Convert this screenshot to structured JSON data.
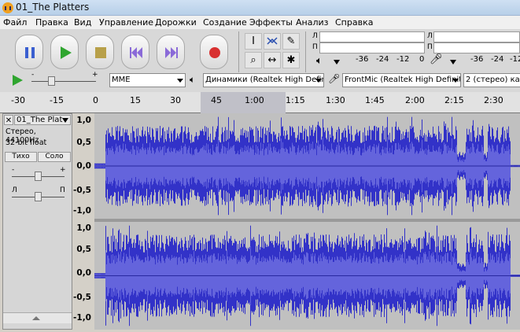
{
  "window": {
    "title": "01_The Platters"
  },
  "menu": [
    "Файл",
    "Правка",
    "Вид",
    "Управление",
    "Дорожки",
    "Создание",
    "Эффекты",
    "Анализ",
    "Справка"
  ],
  "meters": {
    "left": "Л",
    "right": "П",
    "ticks_play": [
      "-36",
      "-24",
      "-12",
      "0"
    ],
    "ticks_rec": [
      "-36",
      "-24",
      "-12"
    ]
  },
  "device": {
    "host": "MME",
    "output": "Динамики (Realtek High Defin",
    "input": "FrontMic (Realtek High Definiti",
    "channels": "2 (стерео) кана"
  },
  "ruler": {
    "labels": [
      "-30",
      "-15",
      "0",
      "15",
      "30",
      "45",
      "1:00",
      "1:15",
      "1:30",
      "1:45",
      "2:00",
      "2:15",
      "2:30"
    ]
  },
  "track": {
    "name": "01_The Plat",
    "info_line1": "Стерео, 44100Hz",
    "info_line2": "32-bit float",
    "mute": "Тихо",
    "solo": "Соло",
    "gain_minus": "-",
    "gain_plus": "+",
    "pan_left": "Л",
    "pan_right": "П"
  },
  "scale": {
    "top": "1,0",
    "upper": "0,5",
    "mid": "0,0",
    "lower": "-0,5",
    "bottom": "-1,0"
  },
  "colors": {
    "wave": "#3232c8",
    "wave_rms": "#6464dc",
    "wave_bg": "#c0c0c0",
    "selection": "#c0c0c8"
  }
}
